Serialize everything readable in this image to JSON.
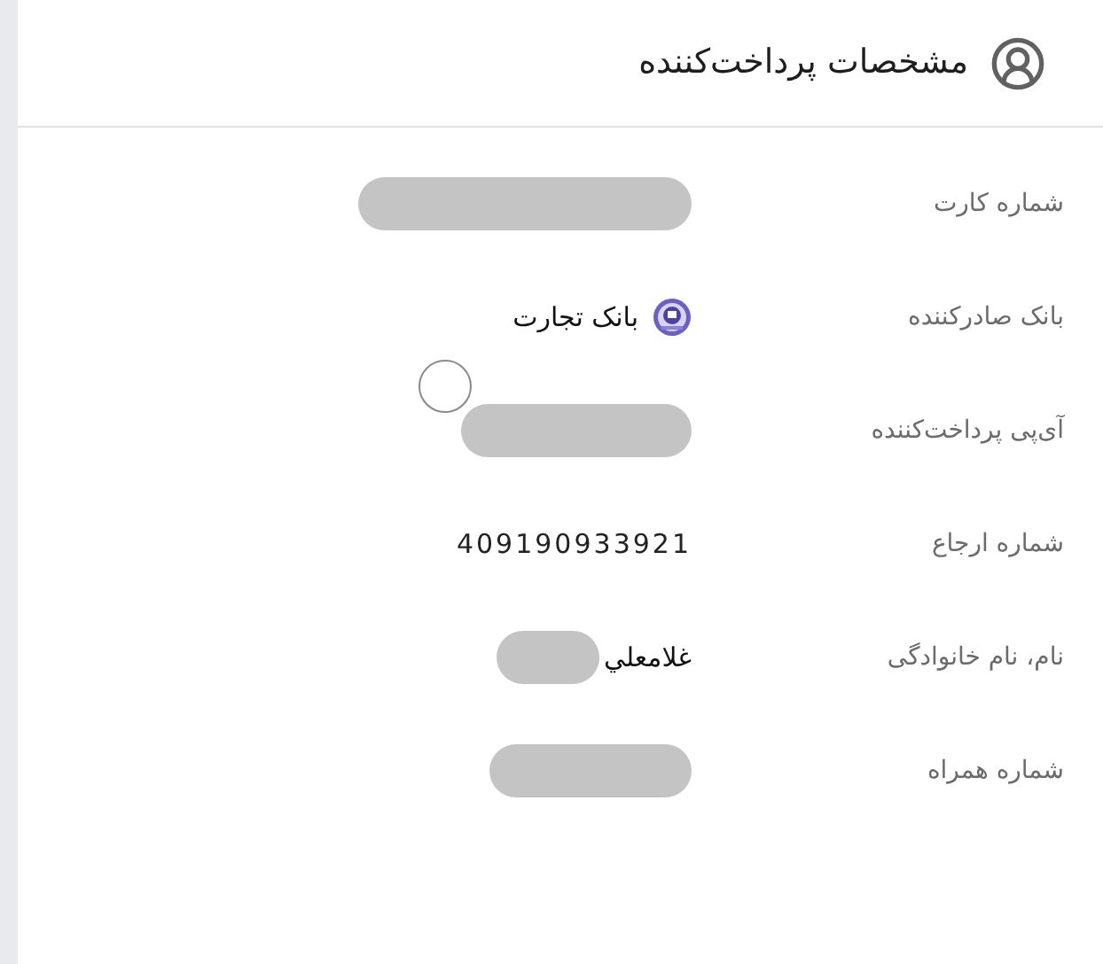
{
  "header": {
    "title": "مشخصات پرداخت‌کننده"
  },
  "rows": [
    {
      "label": "شماره کارت",
      "value": [
        {
          "kind": "redacted"
        }
      ]
    },
    {
      "label": "بانک صادرکننده",
      "value": [
        {
          "kind": "bank",
          "text": "بانک تجارت"
        }
      ]
    },
    {
      "label": "آی‌پی پرداخت‌کننده",
      "value": [
        {
          "kind": "redacted"
        }
      ],
      "marker": true
    },
    {
      "label": "شماره ارجاع",
      "value": [
        {
          "kind": "number",
          "text": "409190933921"
        }
      ]
    },
    {
      "label": "نام، نام خانوادگی",
      "value": [
        {
          "kind": "text",
          "text": "غلامعلي"
        },
        {
          "kind": "redacted"
        }
      ]
    },
    {
      "label": "شماره همراه",
      "value": [
        {
          "kind": "redacted"
        }
      ]
    }
  ]
}
